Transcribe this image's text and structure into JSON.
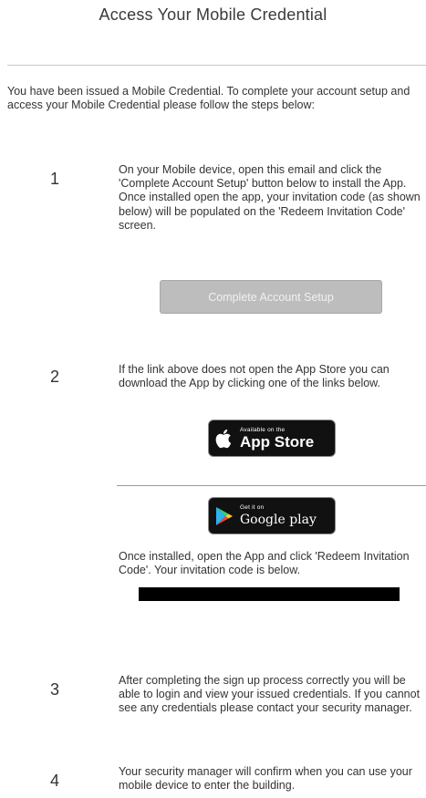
{
  "header": {
    "title": "Access Your Mobile Credential"
  },
  "intro": {
    "text": "You have been issued a Mobile Credential. To complete your account setup and access your Mobile Credential please follow the steps below:"
  },
  "steps": [
    {
      "number": "1",
      "text": "On your Mobile device, open this email and click the 'Complete Account Setup' button below to install the App. Once installed open the app, your invitation code (as shown below) will be populated on the 'Redeem Invitation Code' screen."
    },
    {
      "number": "2",
      "text": "If the link above does not open the App Store you can download the App by clicking one of the links below."
    },
    {
      "number": "3",
      "text": "After completing the sign up process correctly you will be able to login and view your issued credentials. If you cannot see any credentials please contact your security manager."
    },
    {
      "number": "4",
      "text": "Your security manager will confirm when you can use your mobile device to enter the building."
    }
  ],
  "cta": {
    "label": "Complete Account Setup"
  },
  "badges": {
    "app_store": {
      "small": "Available on the",
      "large": "App Store",
      "icon": "apple-icon"
    },
    "google_play": {
      "small": "Get it on",
      "large": "Google play",
      "icon": "google-play-icon"
    }
  },
  "invitation": {
    "text": "Once installed, open the App and click 'Redeem Invitation Code'. Your invitation code is below."
  },
  "colors": {
    "button_bg": "#bdbdbd",
    "badge_bg": "#111111",
    "redaction": "#000000"
  }
}
